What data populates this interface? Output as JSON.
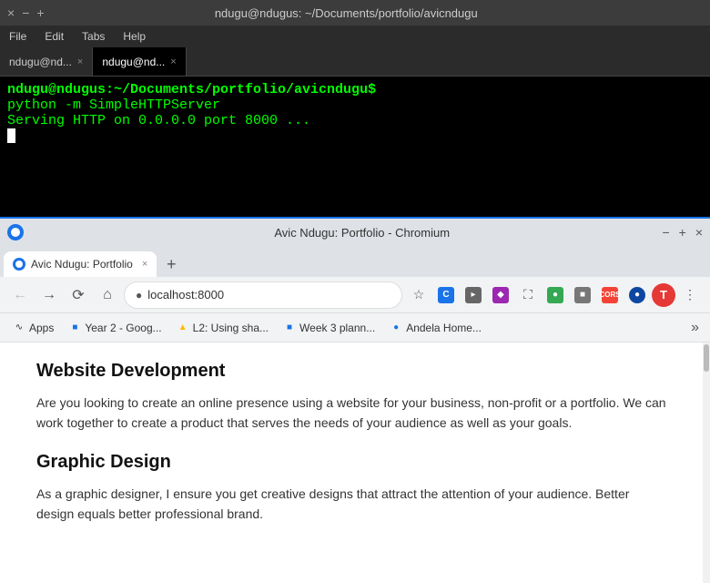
{
  "terminal": {
    "titlebar": {
      "title": "ndugu@ndugus: ~/Documents/portfolio/avicndugu",
      "minimize": "−",
      "maximize": "+",
      "close": "×"
    },
    "menubar": {
      "items": [
        "File",
        "Edit",
        "Tabs",
        "Help"
      ]
    },
    "tabs": [
      {
        "label": "ndugu@nd...",
        "active": false
      },
      {
        "label": "ndugu@nd...",
        "active": true
      }
    ],
    "lines": [
      {
        "type": "prompt",
        "text": "ndugu@ndugus:~/Documents/portfolio/avicndugu$"
      },
      {
        "type": "command",
        "text": " python -m SimpleHTTPServer"
      },
      {
        "type": "output",
        "text": "Serving HTTP on 0.0.0.0 port 8000 ..."
      }
    ]
  },
  "browser": {
    "titlebar": {
      "title": "Avic Ndugu: Portfolio - Chromium",
      "minimize": "−",
      "maximize": "+",
      "close": "×"
    },
    "tab": {
      "label": "Avic Ndugu: Portfolio",
      "close": "×"
    },
    "address": "localhost:8000",
    "bookmarks": [
      {
        "id": "apps",
        "icon": "grid",
        "label": "Apps",
        "color": "#555"
      },
      {
        "id": "year2-google",
        "icon": "doc",
        "label": "Year 2 - Goog...",
        "color": "#1a73e8"
      },
      {
        "id": "l2-using-sha",
        "icon": "drive",
        "label": "L2: Using sha...",
        "color": "#fbbc04"
      },
      {
        "id": "week3-plann",
        "icon": "doc",
        "label": "Week 3 plann...",
        "color": "#1a73e8"
      },
      {
        "id": "andela-home",
        "icon": "globe",
        "label": "Andela Home...",
        "color": "#1a73e8"
      }
    ],
    "content": {
      "sections": [
        {
          "heading": "Website Development",
          "paragraph": "Are you looking to create an online presence using a website for your business, non-profit or a portfolio. We can work together to create a product that serves the needs of your audience as well as your goals."
        },
        {
          "heading": "Graphic Design",
          "paragraph": "As a graphic designer, I ensure you get creative designs that attract the attention of your audience. Better design equals better professional brand."
        }
      ]
    },
    "avatar_letter": "T"
  }
}
